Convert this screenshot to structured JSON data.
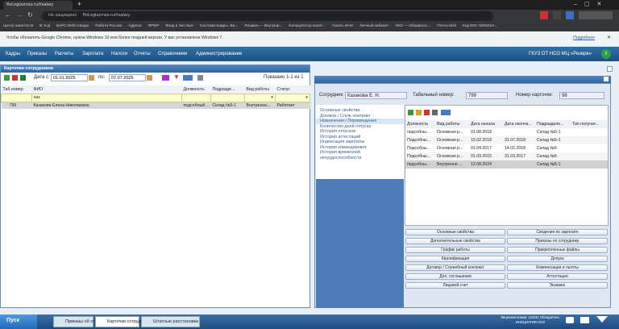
{
  "browser": {
    "tab_title": "fhd.egiszrnso.ru/#salary",
    "not_secure": "Не защищено",
    "url": "fhd.egiszrnso.ru/#salary",
    "bookmarks": [
      "Центр занятости",
      "В Э.Д",
      "БАРС.Web-Своды",
      "Работа России",
      "Адреса",
      "ФРМР",
      "Вход в Экстерн",
      "Система Кадры. Ва...",
      "Лоцман — Внутрор...",
      "Калькулятор колит...",
      "Узнать ИНН",
      "Личный кабинет",
      "ОКЗ — Общеросс...",
      "Почта Mail",
      "Код ЕКС 600943А..."
    ]
  },
  "infobar": {
    "text": "Чтобы обновлять Google Chrome, нужна Windows 10 или более поздней версии. У вас установлена Windows 7.",
    "link": "Подробнее"
  },
  "menu": {
    "items": [
      "Кадры",
      "Приказы",
      "Расчеты",
      "Зарплата",
      "Налоги",
      "Отчеты",
      "Справочники",
      "Администрирование"
    ],
    "org": "ГКУЗ ОТ НСО МЦ «Резерв»"
  },
  "employees": {
    "title": "Карточки сотрудников",
    "date_from_label": "Дата с:",
    "date_from": "01.01.2025",
    "date_to_label": "по:",
    "date_to": "07.07.2025",
    "shown": "Показано 1-1 из 1",
    "columns": [
      "Таб.номер",
      "ФИО",
      "Должность",
      "Подразде...",
      "Вид работы",
      "Статус"
    ],
    "filter_fio": "каз",
    "rows": [
      {
        "tab": "799",
        "fio": "Казакова Елена Николаевна",
        "pos": "подсобный ...",
        "dept": "Склад №5-1",
        "work": "Внутренне...",
        "status": "Работает"
      }
    ]
  },
  "card": {
    "employee_label": "Сотрудник:",
    "employee": "Казакова Е. Н.",
    "tab_label": "Табельный номер:",
    "tab_no": "799",
    "card_label": "Номер карточки:",
    "card_no": "98",
    "nav": [
      "Основные свойства",
      "Договор / Служ. контракт",
      "Назначения / Перемещения",
      "Количество дней отпуска",
      "История отпусков",
      "История аттестаций",
      "Индексация зарплаты",
      "История командировок",
      "История временной нетрудоспособности"
    ],
    "assign_columns": [
      "Должность",
      "Вид работы",
      "Дата начала",
      "Дата оконча...",
      "Подразделе...",
      "Тип получат..."
    ],
    "assign_rows": [
      {
        "pos": "подсобны...",
        "work": "Основная р...",
        "start": "01.08.2018",
        "end": "",
        "dept": "Склад №5-1"
      },
      {
        "pos": "Подсобны...",
        "work": "Основная р...",
        "start": "15.02.2018",
        "end": "31.07.2018",
        "dept": "Склад №5-1"
      },
      {
        "pos": "Подсобны...",
        "work": "Основная р...",
        "start": "01.04.2017",
        "end": "14.02.2018",
        "dept": "Склад №5"
      },
      {
        "pos": "Подсобны...",
        "work": "Основная р...",
        "start": "01.09.2015",
        "end": "31.03.2017",
        "dept": "Склад №5"
      },
      {
        "pos": "подсобны...",
        "work": "Внутренне ...",
        "start": "12.08.2024",
        "end": "",
        "dept": "Склад №5-1"
      }
    ],
    "buttons": [
      "Основные свойства",
      "Сведения по зарплате",
      "Дополнительные свойства",
      "Приказы по сотруднику",
      "График работы",
      "Прикрепленные файлы",
      "Квалификация",
      "Допуск",
      "Договор / Служебный контракт",
      "Компенсации и льготы",
      "Доп. соглашения",
      "Аттестация",
      "Лицевой счет",
      "Экзамен"
    ]
  },
  "taskbar": {
    "start": "Пуск",
    "tabs": [
      "Приказы об отпуске",
      "Карточки сотрудников",
      "Штатные расстановки"
    ],
    "user_line1": "Лицензия номер: 1162N; Обладатель:",
    "user_line2": "ИНИЦИАТИВ НСО"
  }
}
